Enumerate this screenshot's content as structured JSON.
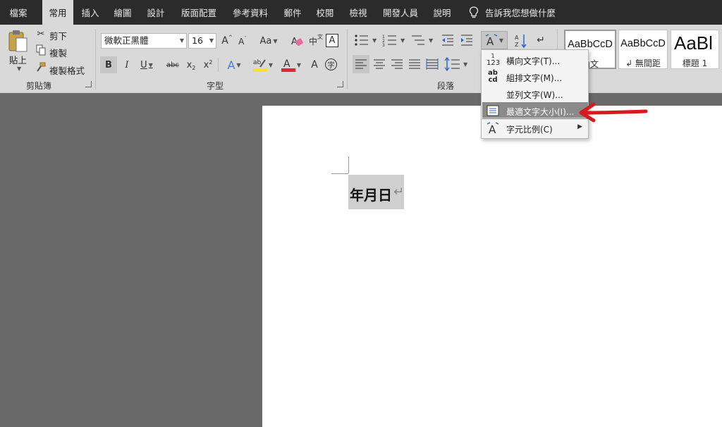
{
  "menubar": {
    "tabs": [
      "檔案",
      "常用",
      "插入",
      "繪圖",
      "設計",
      "版面配置",
      "參考資料",
      "郵件",
      "校閱",
      "檢視",
      "開發人員",
      "說明"
    ],
    "active_tab": "常用",
    "tell_me": "告訴我您想做什麼"
  },
  "clipboard": {
    "paste": "貼上",
    "cut": "剪下",
    "copy": "複製",
    "format_painter": "複製格式",
    "group_label": "剪貼簿"
  },
  "font": {
    "font_name": "微軟正黑體",
    "font_size": "16",
    "change_case": "Aa",
    "group_label": "字型"
  },
  "paragraph": {
    "group_label": "段落"
  },
  "styles": {
    "items": [
      {
        "sample": "AaBbCcD",
        "name": "內文"
      },
      {
        "sample": "AaBbCcD",
        "name": "↲ 無間距"
      },
      {
        "sample": "AaBl",
        "name": "標題 1"
      }
    ]
  },
  "asian_layout_menu": {
    "items": [
      {
        "icon": "horizontal-in-vertical-icon",
        "label": "橫向文字(T)..."
      },
      {
        "icon": "combine-characters-icon",
        "label": "組排文字(M)..."
      },
      {
        "icon": "",
        "label": "並列文字(W)..."
      },
      {
        "icon": "fit-text-icon",
        "label": "最適文字大小(I)..."
      },
      {
        "icon": "character-scaling-icon",
        "label": "字元比例(C)",
        "submenu": true
      }
    ],
    "highlighted": "最適文字大小(I)..."
  },
  "document": {
    "text": "年月日",
    "paragraph_mark": "↵"
  },
  "colors": {
    "menubar": "#2b2b2b",
    "ribbon": "#d9d9d9",
    "workspace": "#6a6a6a",
    "highlight_arrow": "#d9191f",
    "font_color_bar": "#e3262d",
    "highlight_bar": "#f5e51c"
  }
}
